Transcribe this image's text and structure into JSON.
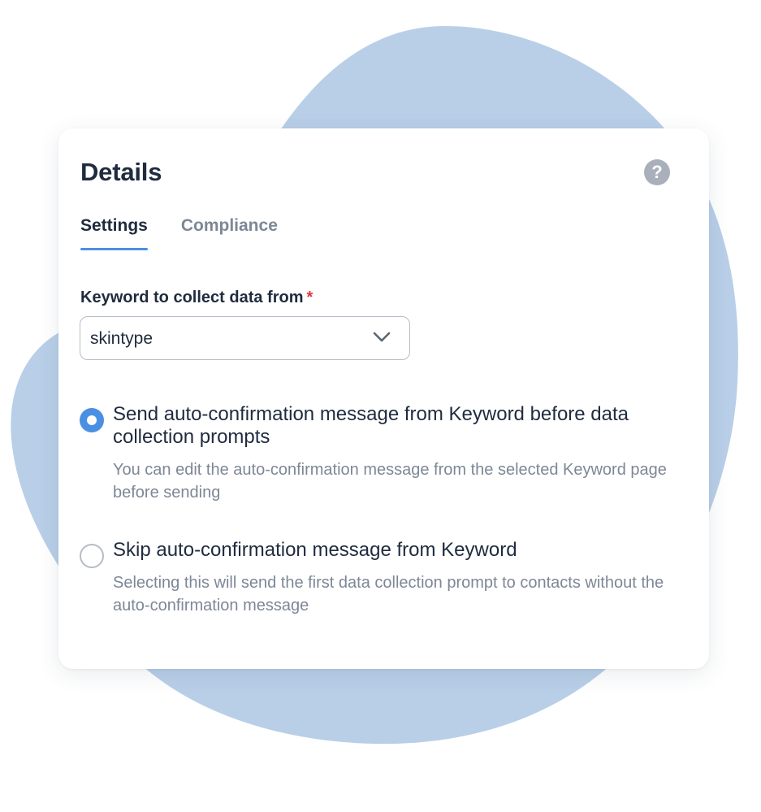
{
  "card": {
    "title": "Details"
  },
  "tabs": [
    {
      "label": "Settings",
      "active": true
    },
    {
      "label": "Compliance",
      "active": false
    }
  ],
  "keyword_field": {
    "label": "Keyword to collect data from",
    "required_mark": "*",
    "value": "skintype"
  },
  "options": [
    {
      "title": "Send auto-confirmation message from Keyword before data collection prompts",
      "description": "You can edit the auto-confirmation message from the selected Keyword page before sending",
      "selected": true
    },
    {
      "title": "Skip auto-confirmation message from Keyword",
      "description": "Selecting this will send the first data collection prompt to contacts without the auto-confirmation message",
      "selected": false
    }
  ],
  "icons": {
    "help": "question-circle-icon",
    "dropdown": "chevron-down-icon",
    "help_glyph": "?"
  },
  "colors": {
    "accent": "#4a90e2",
    "blob": "#b9cfe8",
    "text_primary": "#1f2b3e",
    "text_secondary": "#7d8796",
    "required": "#e0383e"
  }
}
